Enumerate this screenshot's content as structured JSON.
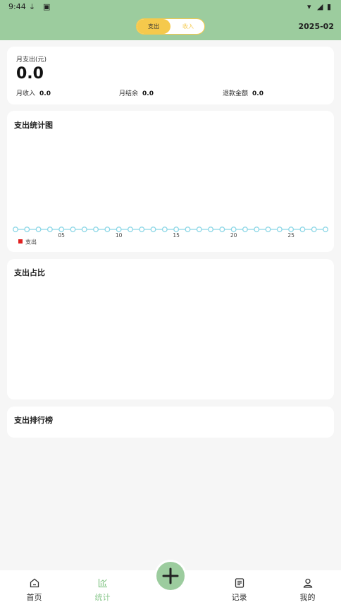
{
  "status": {
    "time": "9:44"
  },
  "header": {
    "seg_expense": "支出",
    "seg_income": "收入",
    "month": "2025-02"
  },
  "summary": {
    "label": "月支出(元)",
    "value": "0.0",
    "income_label": "月收入",
    "income_value": "0.0",
    "balance_label": "月结余",
    "balance_value": "0.0",
    "refund_label": "退款金额",
    "refund_value": "0.0"
  },
  "chart_section": {
    "title": "支出统计图"
  },
  "ratio_section": {
    "title": "支出占比"
  },
  "rank_section": {
    "title": "支出排行榜"
  },
  "chart_data": {
    "type": "line",
    "x": [
      1,
      2,
      3,
      4,
      5,
      6,
      7,
      8,
      9,
      10,
      11,
      12,
      13,
      14,
      15,
      16,
      17,
      18,
      19,
      20,
      21,
      22,
      23,
      24,
      25,
      26,
      27,
      28
    ],
    "xticks": [
      "05",
      "10",
      "15",
      "20",
      "25"
    ],
    "series": [
      {
        "name": "支出",
        "values": [
          0,
          0,
          0,
          0,
          0,
          0,
          0,
          0,
          0,
          0,
          0,
          0,
          0,
          0,
          0,
          0,
          0,
          0,
          0,
          0,
          0,
          0,
          0,
          0,
          0,
          0,
          0,
          0
        ]
      }
    ],
    "line_color": "#8ad6e6",
    "legend_color": "#e02020"
  },
  "tabs": [
    {
      "label": "首页",
      "icon": "home-icon"
    },
    {
      "label": "统计",
      "icon": "chart-icon"
    },
    {
      "label": "记录",
      "icon": "list-icon"
    },
    {
      "label": "我的",
      "icon": "user-icon"
    }
  ],
  "colors": {
    "accent": "#9ccc9e",
    "segment": "#f5c94c"
  }
}
